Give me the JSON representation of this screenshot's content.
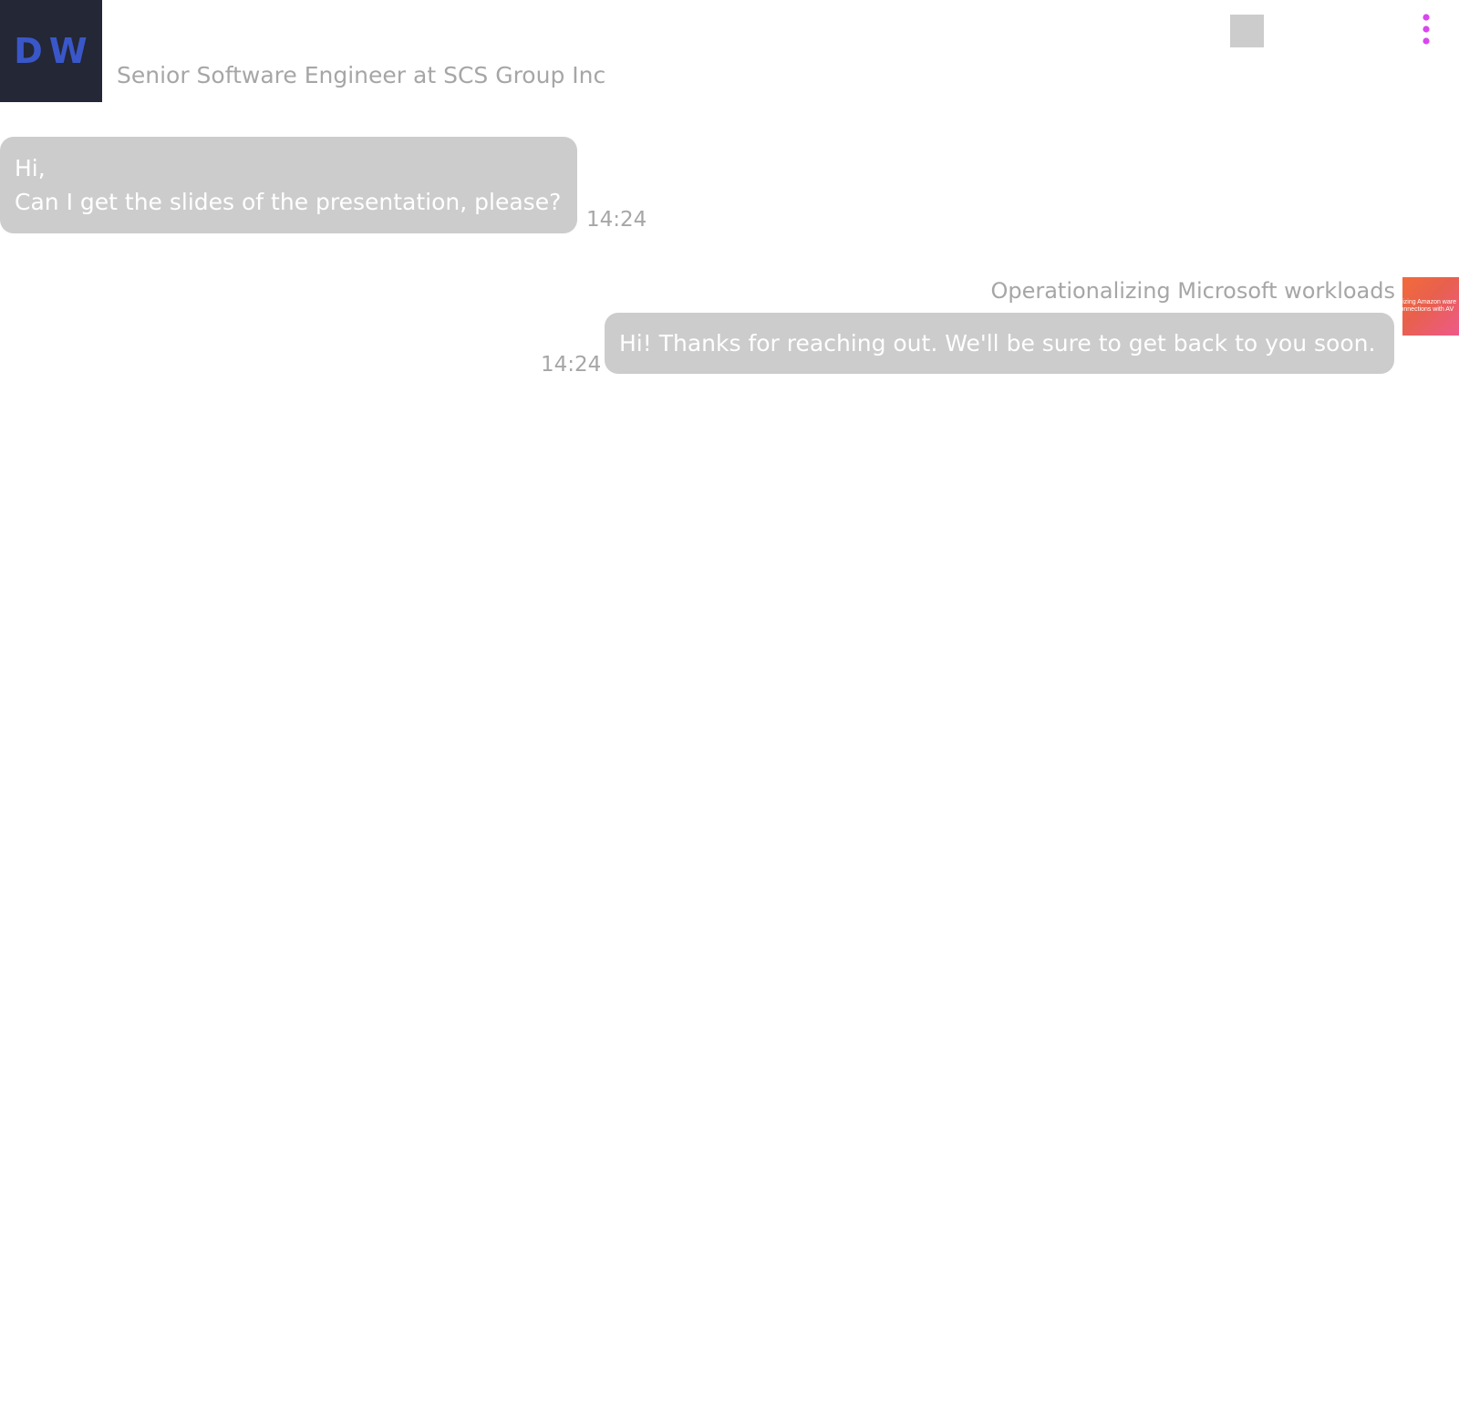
{
  "header": {
    "avatar_initials": "DW",
    "subtitle": "Senior Software Engineer at SCS Group Inc",
    "menu_icon": "more-vertical-icon",
    "menu_icon_color": "#d946ef"
  },
  "messages": [
    {
      "direction": "incoming",
      "lines": [
        "Hi,",
        "Can I get the slides of the presentation, please?"
      ],
      "time": "14:24"
    },
    {
      "direction": "outgoing",
      "attachment_title": "Operationalizing Microsoft workloads",
      "attachment_thumbnail_lines": [
        "rnizing Amazon ware",
        "connections with AV"
      ],
      "lines": [
        "Hi! Thanks for reaching out. We'll be sure to get back to you soon."
      ],
      "time": "14:24"
    }
  ],
  "colors": {
    "avatar_background": "#232736",
    "avatar_text": "#3a57c9",
    "bubble_background": "#cccccc",
    "secondary_text": "#a6a6a6"
  }
}
